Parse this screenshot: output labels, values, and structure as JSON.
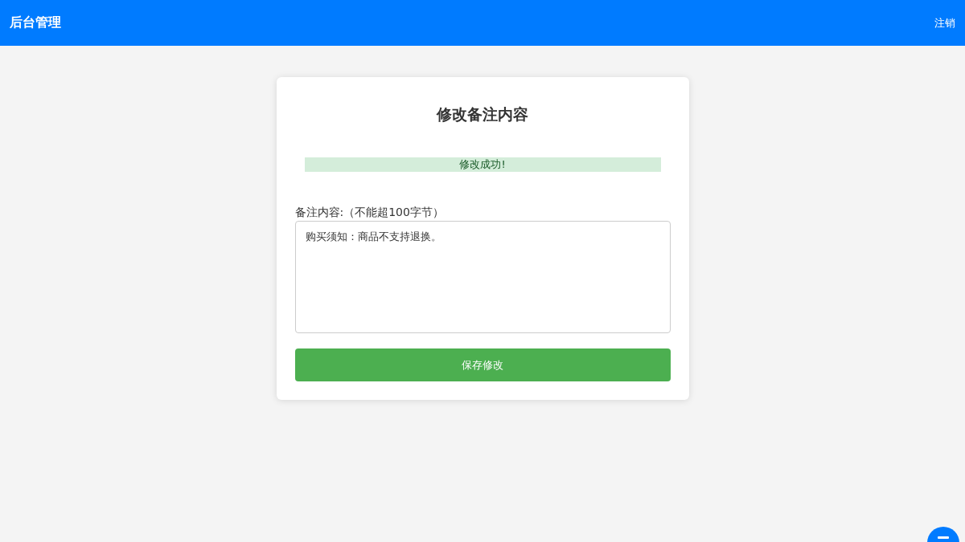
{
  "header": {
    "title": "后台管理",
    "logout": "注销"
  },
  "form": {
    "title": "修改备注内容",
    "message": {
      "kind": "success",
      "text": "修改成功!"
    },
    "label": "备注内容:（不能超100字节）",
    "value": "购买须知：商品不支持退换。",
    "submit": "保存修改"
  }
}
